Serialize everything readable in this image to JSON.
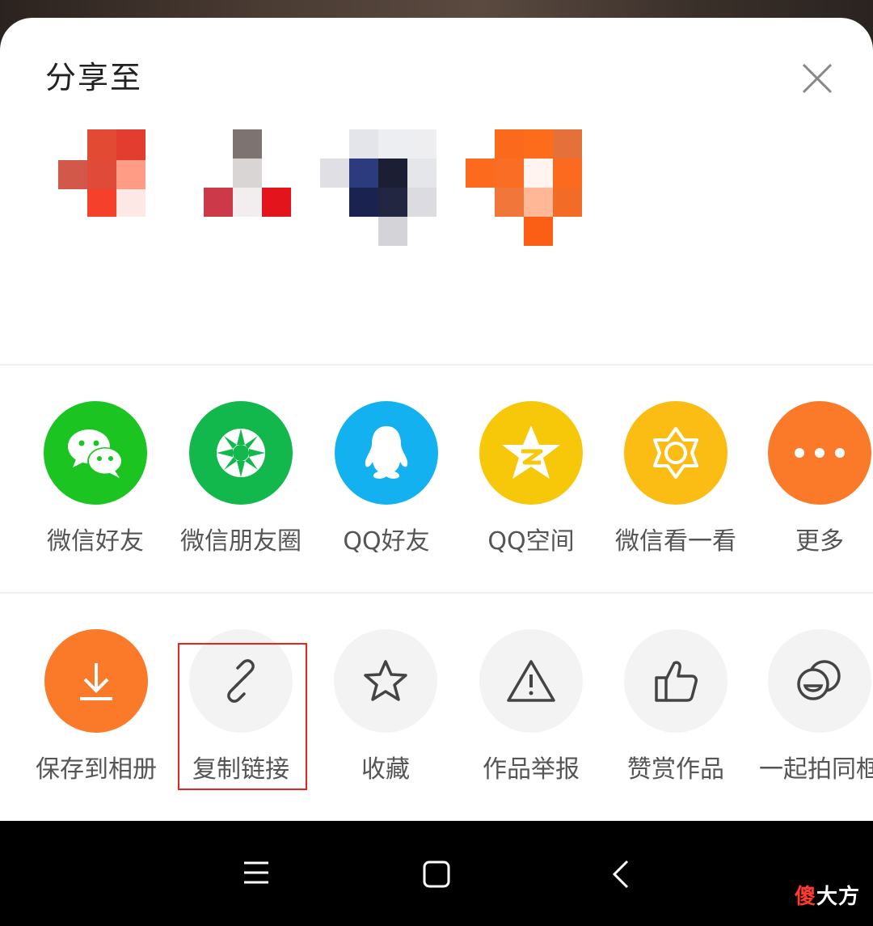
{
  "sheet": {
    "title": "分享至"
  },
  "share_row": [
    {
      "label": "微信好友",
      "icon": "wechat-icon",
      "color": "#1bc421"
    },
    {
      "label": "微信朋友圈",
      "icon": "moments-icon",
      "color": "#12b84c"
    },
    {
      "label": "QQ好友",
      "icon": "qq-icon",
      "color": "#14b1f0"
    },
    {
      "label": "QQ空间",
      "icon": "qzone-icon",
      "color": "#f7c70a"
    },
    {
      "label": "微信看一看",
      "icon": "wechat-look-icon",
      "color": "#fbbd14"
    },
    {
      "label": "更多",
      "icon": "more-icon",
      "color": "#fb7a29"
    }
  ],
  "action_row": [
    {
      "label": "保存到相册",
      "icon": "download-icon",
      "color": "#fb7a29"
    },
    {
      "label": "复制链接",
      "icon": "link-icon",
      "highlighted": true
    },
    {
      "label": "收藏",
      "icon": "star-icon"
    },
    {
      "label": "作品举报",
      "icon": "warning-icon"
    },
    {
      "label": "赞赏作品",
      "icon": "thumbs-up-icon"
    },
    {
      "label": "一起拍同框",
      "icon": "duet-icon"
    }
  ],
  "watermark": {
    "part1": "傻",
    "part2": "大方"
  },
  "colors": {
    "highlight_border": "#e8241f",
    "label_text": "#555555"
  }
}
